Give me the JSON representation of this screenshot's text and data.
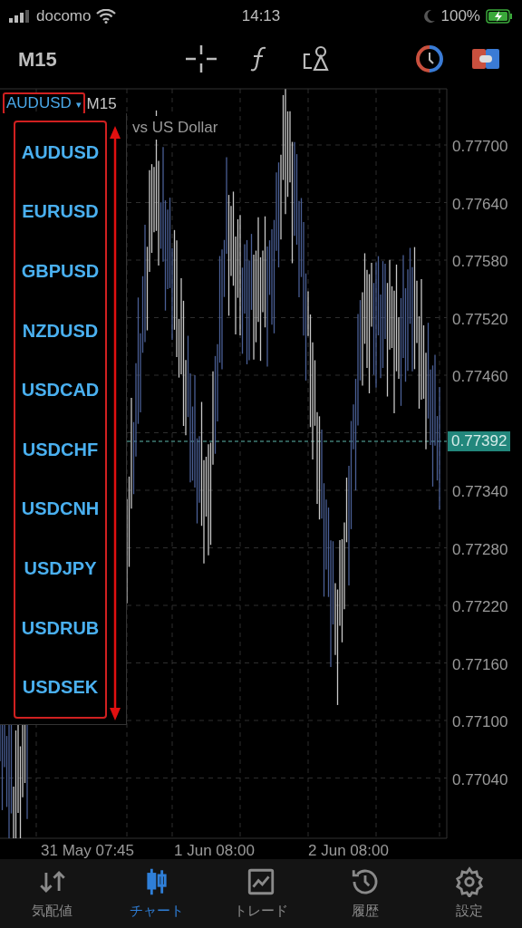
{
  "status_bar": {
    "carrier": "docomo",
    "time": "14:13",
    "battery": "100%"
  },
  "toolbar": {
    "timeframe": "M15"
  },
  "chart": {
    "symbol": "AUDUSD",
    "caret": "▾",
    "timeframe": "M15",
    "title": "vs US Dollar",
    "current_price": "0.77392",
    "price_labels_above": [
      "0.77700",
      "0.77640",
      "0.77580",
      "0.77520",
      "0.77460"
    ],
    "price_labels_below": [
      "0.77340",
      "0.77280",
      "0.77220",
      "0.77160",
      "0.77100",
      "0.77040"
    ],
    "time_labels": [
      "31 May 07:45",
      "1 Jun 08:00",
      "2 Jun 08:00"
    ]
  },
  "symbol_menu": {
    "items": [
      {
        "label": "AUDUSD"
      },
      {
        "label": "EURUSD"
      },
      {
        "label": "GBPUSD"
      },
      {
        "label": "NZDUSD"
      },
      {
        "label": "USDCAD"
      },
      {
        "label": "USDCHF"
      },
      {
        "label": "USDCNH"
      },
      {
        "label": "USDJPY"
      },
      {
        "label": "USDRUB"
      },
      {
        "label": "USDSEK"
      }
    ]
  },
  "nav": [
    {
      "label": "気配値",
      "kind": "quotes",
      "selected": false
    },
    {
      "label": "チャート",
      "kind": "chart",
      "selected": true
    },
    {
      "label": "トレード",
      "kind": "trade",
      "selected": false
    },
    {
      "label": "履歴",
      "kind": "history",
      "selected": false
    },
    {
      "label": "設定",
      "kind": "settings",
      "selected": false
    }
  ]
}
